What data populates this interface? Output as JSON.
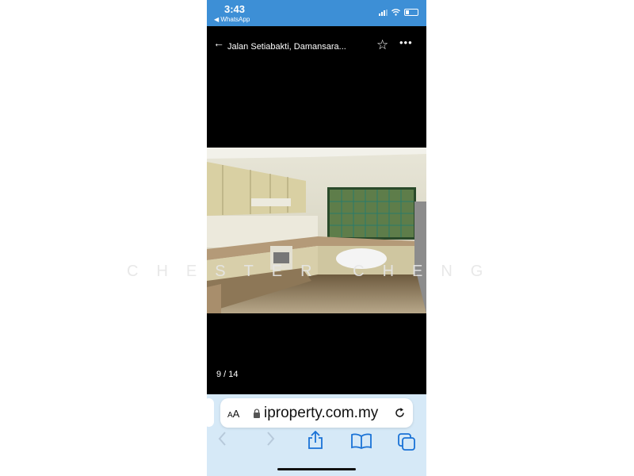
{
  "status_bar": {
    "time": "3:43",
    "back_app": "◀ WhatsApp",
    "color": "#3d8fd6"
  },
  "header": {
    "title": "Jalan Setiabakti, Damansara..."
  },
  "gallery": {
    "counter": "9 / 14"
  },
  "watermark": {
    "text": "CHESTER CHENG"
  },
  "browser": {
    "text_size_label": "AA",
    "url": "iproperty.com.my",
    "background": "#d6e9f7"
  },
  "icons": {
    "back": "back-arrow-icon",
    "favorite": "star-icon",
    "more": "more-icon",
    "lock": "lock-icon",
    "reload": "reload-icon",
    "prev": "chevron-left-icon",
    "next": "chevron-right-icon",
    "share": "share-icon",
    "bookmarks": "book-icon",
    "tabs": "tabs-icon"
  }
}
